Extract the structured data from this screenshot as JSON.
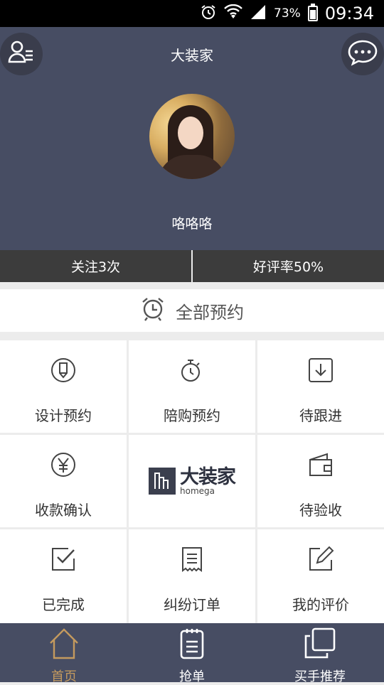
{
  "status_bar": {
    "battery": "73%",
    "time": "09:34"
  },
  "header": {
    "title": "大装家",
    "username": "咯咯咯"
  },
  "stats": {
    "follow": "关注3次",
    "rating": "好评率50%"
  },
  "all_orders": {
    "label": "全部预约"
  },
  "grid": {
    "design": "设计预约",
    "accompany": "陪购预约",
    "follow_up": "待跟进",
    "payment": "收款确认",
    "logo_cn": "大装家",
    "logo_en": "homega",
    "inspect": "待验收",
    "done": "已完成",
    "dispute": "纠纷订单",
    "my_review": "我的评价"
  },
  "tabs": {
    "home": "首页",
    "grab": "抢单",
    "recommend": "买手推荐"
  },
  "colors": {
    "header_bg": "#474d63",
    "active_tab": "#c49a5e",
    "stats_bg": "#3c3c3c"
  }
}
